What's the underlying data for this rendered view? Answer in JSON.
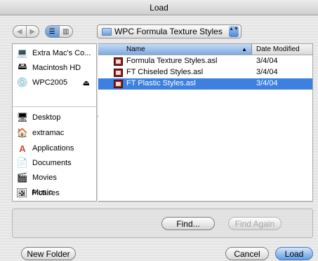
{
  "window": {
    "title": "Load"
  },
  "toolbar": {
    "back_glyph": "◀",
    "forward_glyph": "▶",
    "list_view_glyph": "☰",
    "column_view_glyph": "▥",
    "location": "WPC Formula Texture Styles",
    "location_arrows": "▲▼"
  },
  "sidebar": {
    "items": [
      {
        "label": "Extra Mac's Co...",
        "icon": "computer-icon",
        "glyph": "💻"
      },
      {
        "label": "Macintosh HD",
        "icon": "hard-drive-icon",
        "glyph": "🖴"
      },
      {
        "label": "WPC2005",
        "icon": "disc-icon",
        "glyph": "💿",
        "eject": "⏏"
      },
      {
        "label": "Desktop",
        "icon": "desktop-icon",
        "glyph": "🖥"
      },
      {
        "label": "extramac",
        "icon": "home-icon",
        "glyph": "🏠"
      },
      {
        "label": "Applications",
        "icon": "applications-icon",
        "glyph": "A"
      },
      {
        "label": "Documents",
        "icon": "documents-icon",
        "glyph": "📄"
      },
      {
        "label": "Movies",
        "icon": "movies-icon",
        "glyph": "🎬"
      },
      {
        "label": "Music",
        "icon": "music-icon",
        "glyph": "♪"
      },
      {
        "label": "Pictures",
        "icon": "pictures-icon",
        "glyph": "🖼"
      }
    ]
  },
  "file_list": {
    "columns": {
      "name": "Name",
      "date": "Date Modified",
      "sort_glyph": "▲"
    },
    "rows": [
      {
        "name": "Formula Texture Styles.asl",
        "date": "3/4/04",
        "selected": false
      },
      {
        "name": "FT Chiseled Styles.asl",
        "date": "3/4/04",
        "selected": false
      },
      {
        "name": "FT Plastic Styles.asl",
        "date": "3/4/04",
        "selected": true
      }
    ]
  },
  "buttons": {
    "find": "Find...",
    "find_again": "Find Again",
    "new_folder": "New Folder",
    "cancel": "Cancel",
    "load": "Load"
  },
  "colors": {
    "selection": "#3d80df",
    "accent": "#5f9ce3"
  }
}
